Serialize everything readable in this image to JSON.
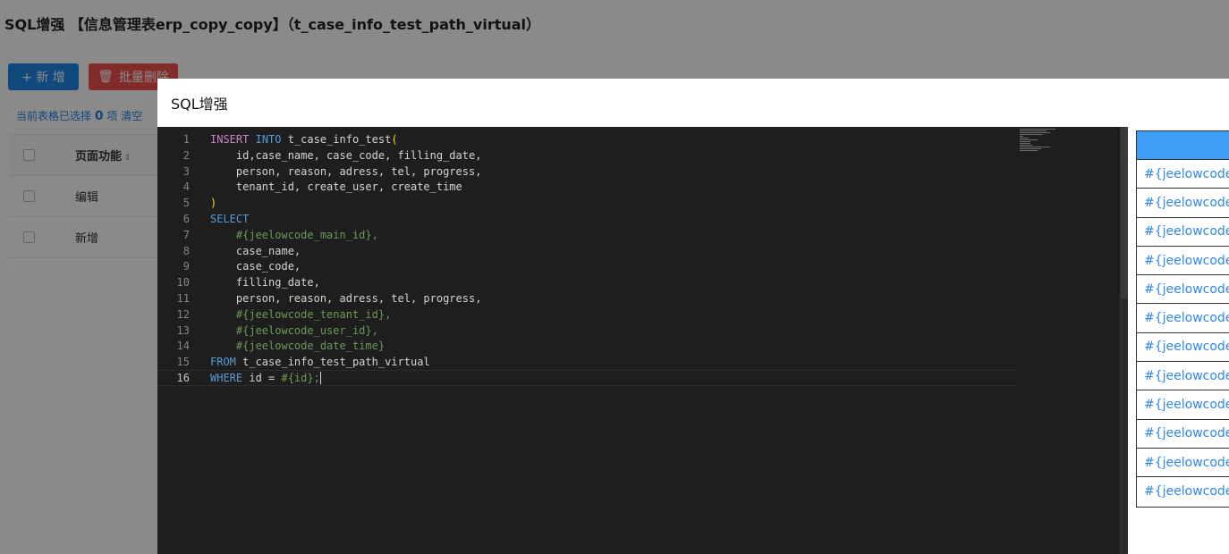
{
  "page": {
    "title": "SQL增强 【信息管理表erp_copy_copy】（t_case_info_test_path_virtual）",
    "add_button": "+ 新 增",
    "batch_delete_button": "批量删除",
    "selection_prefix": "当前表格已选择",
    "selection_count": "0",
    "selection_suffix": "项",
    "clear_link": "清空",
    "table": {
      "header": "页面功能",
      "rows": [
        "编辑",
        "新增"
      ]
    }
  },
  "modal": {
    "title": "SQL增强"
  },
  "editor": {
    "lines": [
      [
        {
          "t": "INSERT",
          "c": "kw1"
        },
        {
          "t": " "
        },
        {
          "t": "INTO",
          "c": "kw2"
        },
        {
          "t": " t_case_info_test"
        },
        {
          "t": "(",
          "c": "paren"
        }
      ],
      [
        {
          "t": "    id,case_name, case_code, filling_date,"
        }
      ],
      [
        {
          "t": "    person, reason, adress, tel, progress,"
        }
      ],
      [
        {
          "t": "    tenant_id, create_user, create_time"
        }
      ],
      [
        {
          "t": ")",
          "c": "paren"
        }
      ],
      [
        {
          "t": "SELECT",
          "c": "kw2"
        }
      ],
      [
        {
          "t": "    "
        },
        {
          "t": "#{jeelowcode_main_id},",
          "c": "var"
        }
      ],
      [
        {
          "t": "    case_name,"
        }
      ],
      [
        {
          "t": "    case_code,"
        }
      ],
      [
        {
          "t": "    filling_date,"
        }
      ],
      [
        {
          "t": "    person, reason, adress, tel, progress,"
        }
      ],
      [
        {
          "t": "    "
        },
        {
          "t": "#{jeelowcode_tenant_id},",
          "c": "var"
        }
      ],
      [
        {
          "t": "    "
        },
        {
          "t": "#{jeelowcode_user_id},",
          "c": "var"
        }
      ],
      [
        {
          "t": "    "
        },
        {
          "t": "#{jeelowcode_date_time}",
          "c": "var"
        }
      ],
      [
        {
          "t": "FROM",
          "c": "kw2"
        },
        {
          "t": " t_case_info_test_path_virtual"
        }
      ],
      [
        {
          "t": "WHERE",
          "c": "kw2"
        },
        {
          "t": " id = "
        },
        {
          "t": "#{id};",
          "c": "var"
        }
      ]
    ],
    "active_line": 16
  },
  "variables": {
    "rows": [
      "#{jeelowcode_",
      "#{jeelowcode_",
      "#{jeelowcode_",
      "#{jeelowcode_",
      "#{jeelowcode_",
      "#{jeelowcode_",
      "#{jeelowcode_",
      "#{jeelowcode_",
      "#{jeelowcode_",
      "#{jeelowcode_",
      "#{jeelowcode_",
      "#{jeelowcode_"
    ]
  },
  "colors": {
    "primary": "#1e88e5",
    "danger": "#f0504f",
    "editor_bg": "#1e1e1e",
    "var_header": "#3f9cf7"
  }
}
